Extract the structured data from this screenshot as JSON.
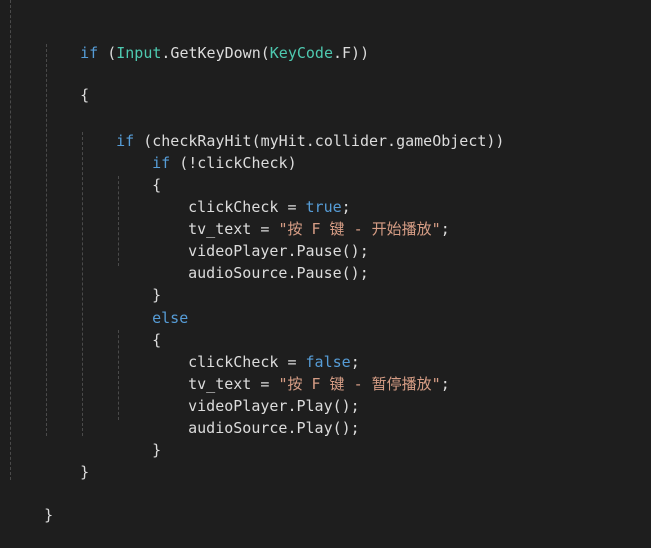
{
  "code": {
    "if_kw": "if",
    "open_paren": " (",
    "input_class": "Input",
    "get_key_down": ".GetKeyDown(",
    "keycode_class": "KeyCode",
    "key_f_close": ".F))",
    "brace_open": "{",
    "brace_close": "}",
    "check_ray_call": " (checkRayHit(myHit.collider.gameObject))",
    "not_click_check": " (!clickCheck)",
    "assign_click_check": "clickCheck = ",
    "true_kw": "true",
    "false_kw": "false",
    "semicolon": ";",
    "assign_tv_text": "tv_text = ",
    "str_start_play": "\"按 F 键 - 开始播放\"",
    "str_pause_play": "\"按 F 键 - 暂停播放\"",
    "video_pause": "videoPlayer.Pause();",
    "audio_pause": "audioSource.Pause();",
    "video_play": "videoPlayer.Play();",
    "audio_play": "audioSource.Play();",
    "else_kw": "else"
  },
  "colors": {
    "background": "#1e1e1e",
    "keyword": "#569cd6",
    "type": "#4ec9b0",
    "string": "#d69d85",
    "text": "#dcdcdc"
  }
}
